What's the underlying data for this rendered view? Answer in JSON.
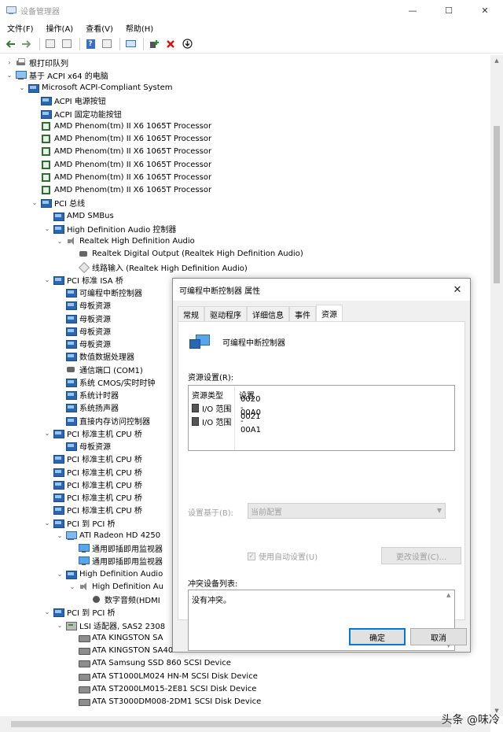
{
  "window": {
    "title": "设备管理器"
  },
  "controls": {
    "minimize": "—",
    "maximize": "☐",
    "close": "✕"
  },
  "menu": [
    "文件(F)",
    "操作(A)",
    "查看(V)",
    "帮助(H)"
  ],
  "tree": [
    {
      "label": "根打印队列",
      "icon": "printer",
      "depth": 1,
      "tw": "collapsed"
    },
    {
      "label": "基于 ACPI x64 的电脑",
      "icon": "computer",
      "depth": 1,
      "tw": "expanded"
    },
    {
      "label": "Microsoft ACPI-Compliant System",
      "icon": "sys",
      "depth": 2,
      "tw": "expanded"
    },
    {
      "label": "ACPI 电源按钮",
      "icon": "sys",
      "depth": 3,
      "tw": "none"
    },
    {
      "label": "ACPI 固定功能按钮",
      "icon": "sys",
      "depth": 3,
      "tw": "none"
    },
    {
      "label": "AMD Phenom(tm) II X6 1065T Processor",
      "icon": "cpu",
      "depth": 3,
      "tw": "none"
    },
    {
      "label": "AMD Phenom(tm) II X6 1065T Processor",
      "icon": "cpu",
      "depth": 3,
      "tw": "none"
    },
    {
      "label": "AMD Phenom(tm) II X6 1065T Processor",
      "icon": "cpu",
      "depth": 3,
      "tw": "none"
    },
    {
      "label": "AMD Phenom(tm) II X6 1065T Processor",
      "icon": "cpu",
      "depth": 3,
      "tw": "none"
    },
    {
      "label": "AMD Phenom(tm) II X6 1065T Processor",
      "icon": "cpu",
      "depth": 3,
      "tw": "none"
    },
    {
      "label": "AMD Phenom(tm) II X6 1065T Processor",
      "icon": "cpu",
      "depth": 3,
      "tw": "none"
    },
    {
      "label": "PCI 总线",
      "icon": "sys",
      "depth": 3,
      "tw": "expanded"
    },
    {
      "label": "AMD SMBus",
      "icon": "sys",
      "depth": 4,
      "tw": "none"
    },
    {
      "label": "High Definition Audio 控制器",
      "icon": "sys",
      "depth": 4,
      "tw": "expanded"
    },
    {
      "label": "Realtek High Definition Audio",
      "icon": "audio",
      "depth": 5,
      "tw": "expanded"
    },
    {
      "label": "Realtek Digital Output (Realtek High Definition Audio)",
      "icon": "port",
      "depth": 6,
      "tw": "none"
    },
    {
      "label": "线路输入 (Realtek High Definition Audio)",
      "icon": "line",
      "depth": 6,
      "tw": "none"
    },
    {
      "label": "PCI 标准 ISA 桥",
      "icon": "sys",
      "depth": 4,
      "tw": "expanded"
    },
    {
      "label": "可编程中断控制器",
      "icon": "sys",
      "depth": 5,
      "tw": "none"
    },
    {
      "label": "母板资源",
      "icon": "sys",
      "depth": 5,
      "tw": "none"
    },
    {
      "label": "母板资源",
      "icon": "sys",
      "depth": 5,
      "tw": "none"
    },
    {
      "label": "母板资源",
      "icon": "sys",
      "depth": 5,
      "tw": "none"
    },
    {
      "label": "母板资源",
      "icon": "sys",
      "depth": 5,
      "tw": "none"
    },
    {
      "label": "数值数据处理器",
      "icon": "sys",
      "depth": 5,
      "tw": "none"
    },
    {
      "label": "通信端口 (COM1)",
      "icon": "port",
      "depth": 5,
      "tw": "none"
    },
    {
      "label": "系统 CMOS/实时时钟",
      "icon": "sys",
      "depth": 5,
      "tw": "none"
    },
    {
      "label": "系统计时器",
      "icon": "sys",
      "depth": 5,
      "tw": "none"
    },
    {
      "label": "系统扬声器",
      "icon": "sys",
      "depth": 5,
      "tw": "none"
    },
    {
      "label": "直接内存访问控制器",
      "icon": "sys",
      "depth": 5,
      "tw": "none"
    },
    {
      "label": "PCI 标准主机 CPU 桥",
      "icon": "sys",
      "depth": 4,
      "tw": "expanded"
    },
    {
      "label": "母板资源",
      "icon": "sys",
      "depth": 5,
      "tw": "none"
    },
    {
      "label": "PCI 标准主机 CPU 桥",
      "icon": "sys",
      "depth": 4,
      "tw": "none"
    },
    {
      "label": "PCI 标准主机 CPU 桥",
      "icon": "sys",
      "depth": 4,
      "tw": "none"
    },
    {
      "label": "PCI 标准主机 CPU 桥",
      "icon": "sys",
      "depth": 4,
      "tw": "none"
    },
    {
      "label": "PCI 标准主机 CPU 桥",
      "icon": "sys",
      "depth": 4,
      "tw": "none"
    },
    {
      "label": "PCI 标准主机 CPU 桥",
      "icon": "sys",
      "depth": 4,
      "tw": "none"
    },
    {
      "label": "PCI 到 PCI 桥",
      "icon": "sys",
      "depth": 4,
      "tw": "expanded"
    },
    {
      "label": "ATI Radeon HD 4250",
      "icon": "gpu",
      "depth": 5,
      "tw": "expanded"
    },
    {
      "label": "通用即插即用监视器",
      "icon": "monitor",
      "depth": 6,
      "tw": "none"
    },
    {
      "label": "通用即插即用监视器",
      "icon": "monitor",
      "depth": 6,
      "tw": "none"
    },
    {
      "label": "High Definition Audio",
      "icon": "sys",
      "depth": 5,
      "tw": "expanded"
    },
    {
      "label": "High Definition Au",
      "icon": "audio",
      "depth": 6,
      "tw": "expanded"
    },
    {
      "label": "数字音频(HDMI",
      "icon": "speaker",
      "depth": 7,
      "tw": "none"
    },
    {
      "label": "PCI 到 PCI 桥",
      "icon": "sys",
      "depth": 4,
      "tw": "expanded"
    },
    {
      "label": "LSI 适配器, SAS2 2308",
      "icon": "scsi",
      "depth": 5,
      "tw": "expanded"
    },
    {
      "label": "ATA KINGSTON SA",
      "icon": "disk",
      "depth": 6,
      "tw": "none"
    },
    {
      "label": "ATA KINGSTON SA400S3 SCSI Disk Device",
      "icon": "disk",
      "depth": 6,
      "tw": "none"
    },
    {
      "label": "ATA Samsung SSD 860 SCSI Device",
      "icon": "disk",
      "depth": 6,
      "tw": "none"
    },
    {
      "label": "ATA ST1000LM024 HN-M SCSI Disk Device",
      "icon": "disk",
      "depth": 6,
      "tw": "none"
    },
    {
      "label": "ATA ST2000LM015-2E81 SCSI Disk Device",
      "icon": "disk",
      "depth": 6,
      "tw": "none"
    },
    {
      "label": "ATA ST3000DM008-2DM1 SCSI Disk Device",
      "icon": "disk",
      "depth": 6,
      "tw": "none"
    }
  ],
  "dialog": {
    "title": "可编程中断控制器 属性",
    "close": "✕",
    "tabs": [
      "常规",
      "驱动程序",
      "详细信息",
      "事件",
      "资源"
    ],
    "active_tab": "资源",
    "device_name": "可编程中断控制器",
    "resource_settings_label": "资源设置(R):",
    "col_type": "资源类型",
    "col_setting": "设置",
    "resources": [
      {
        "type": "I/O 范围",
        "value": "0020 - 0021"
      },
      {
        "type": "I/O 范围",
        "value": "00A0 - 00A1"
      }
    ],
    "based_on_label": "设置基于(B):",
    "based_on_value": "当前配置",
    "auto_settings_label": "使用自动设置(U)",
    "auto_settings_checked": true,
    "change_settings_button": "更改设置(C)...",
    "conflict_label": "冲突设备列表:",
    "conflict_text": "没有冲突。",
    "ok_button": "确定",
    "cancel_button": "取消"
  },
  "watermark": "头条 @味冷"
}
